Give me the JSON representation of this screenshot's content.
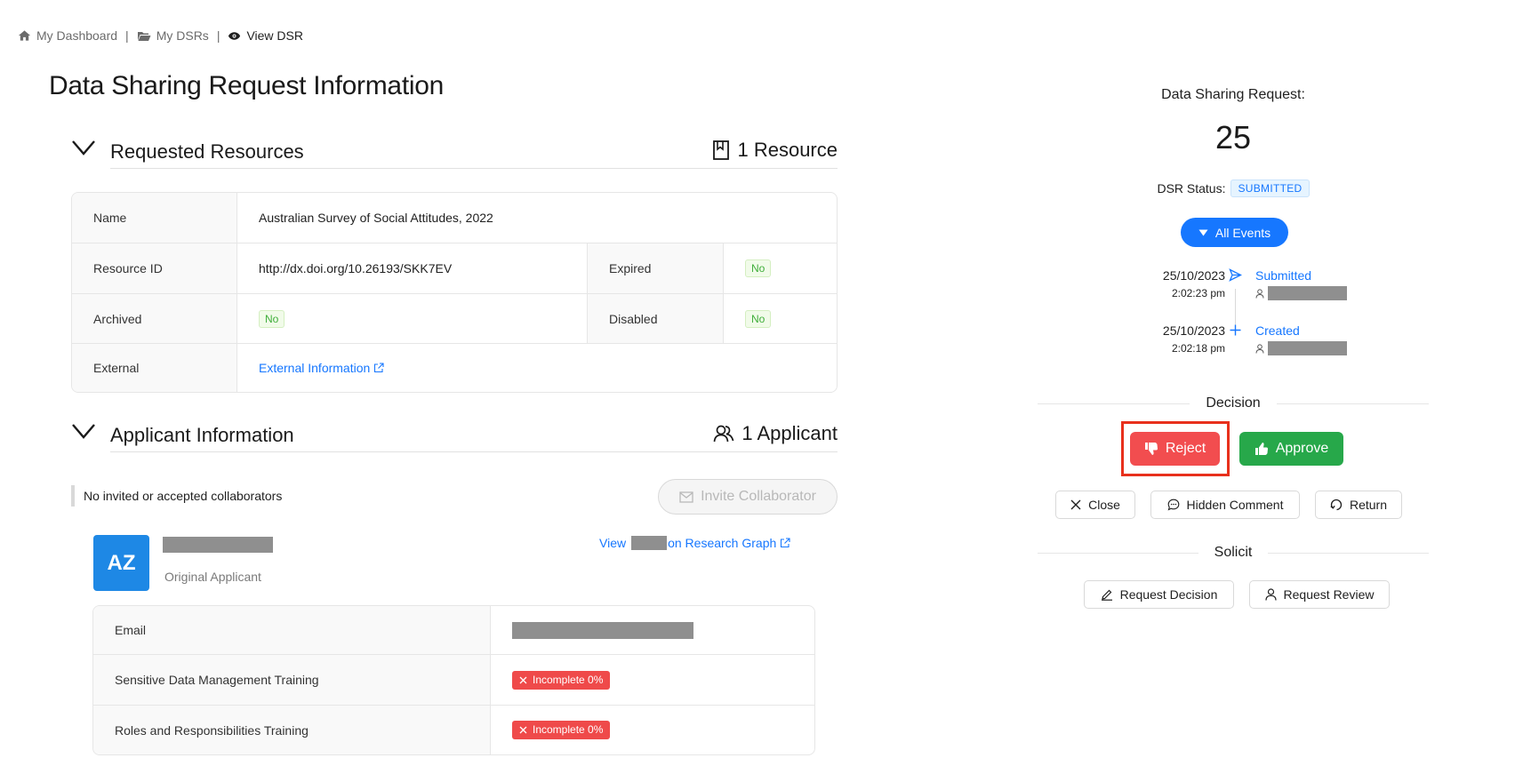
{
  "breadcrumb": {
    "items": [
      {
        "label": "My Dashboard",
        "icon": "home-icon"
      },
      {
        "label": "My DSRs",
        "icon": "folder-open-icon"
      },
      {
        "label": "View DSR",
        "icon": "eye-icon"
      }
    ],
    "separator": "|"
  },
  "page_title": "Data Sharing Request Information",
  "resources": {
    "title": "Requested Resources",
    "count_label": "1 Resource",
    "rows": {
      "name_label": "Name",
      "name_value": "Australian Survey of Social Attitudes, 2022",
      "resource_id_label": "Resource ID",
      "resource_id_value": "http://dx.doi.org/10.26193/SKK7EV",
      "expired_label": "Expired",
      "expired_value": "No",
      "archived_label": "Archived",
      "archived_value": "No",
      "disabled_label": "Disabled",
      "disabled_value": "No",
      "external_label": "External",
      "external_value": "External Information"
    }
  },
  "applicants": {
    "title": "Applicant Information",
    "count_label": "1 Applicant",
    "no_collaborators": "No invited or accepted collaborators",
    "invite_button": "Invite Collaborator",
    "applicant": {
      "initials": "AZ",
      "role": "Original Applicant",
      "research_link_prefix": "View",
      "research_link_suffix": "on Research Graph"
    },
    "rows": {
      "email_label": "Email",
      "sdm_label": "Sensitive Data Management Training",
      "sdm_value": "Incomplete 0%",
      "rr_label": "Roles and Responsibilities Training",
      "rr_value": "Incomplete 0%"
    }
  },
  "panel": {
    "title": "Data Sharing Request:",
    "number": "25",
    "status_label": "DSR Status:",
    "status_value": "SUBMITTED",
    "events_button": "All Events",
    "events": [
      {
        "date": "25/10/2023",
        "time": "2:02:23 pm",
        "name": "Submitted",
        "icon": "send-icon"
      },
      {
        "date": "25/10/2023",
        "time": "2:02:18 pm",
        "name": "Created",
        "icon": "plus-icon"
      }
    ],
    "decision_title": "Decision",
    "reject_button": "Reject",
    "approve_button": "Approve",
    "close_button": "Close",
    "hidden_comment_button": "Hidden Comment",
    "return_button": "Return",
    "solicit_title": "Solicit",
    "request_decision_button": "Request Decision",
    "request_review_button": "Request Review"
  },
  "colors": {
    "primary": "#1677ff",
    "reject": "#f24d4f",
    "approve": "#27a84a",
    "highlight": "#e8301c",
    "incomplete": "#ef4a4a",
    "tag_green": "#3fae3a"
  }
}
